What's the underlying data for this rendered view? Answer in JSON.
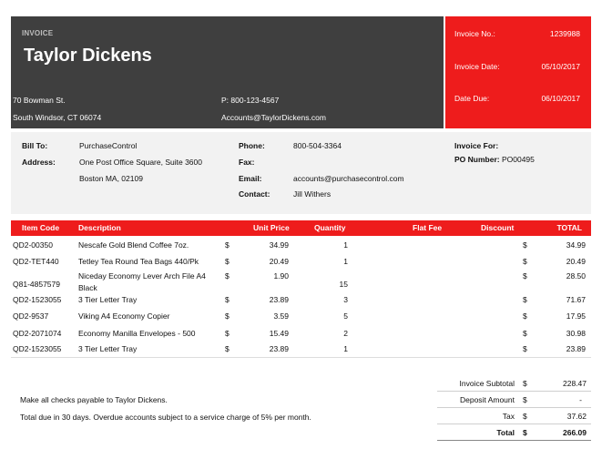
{
  "header": {
    "label": "INVOICE",
    "company": "Taylor Dickens",
    "address_line1": "70 Bowman St.",
    "address_line2": "South Windsor, CT 06074",
    "phone": "P: 800-123-4567",
    "email": "Accounts@TaylorDickens.com"
  },
  "invoice_meta": {
    "number_label": "Invoice No.:",
    "number": "1239988",
    "date_label": "Invoice Date:",
    "date": "05/10/2017",
    "due_label": "Date Due:",
    "due": "06/10/2017"
  },
  "bill_to": {
    "bill_to_label": "Bill To:",
    "bill_to": "PurchaseControl",
    "address_label": "Address:",
    "address_line1": "One Post Office Square, Suite 3600",
    "address_line2": "Boston MA, 02109",
    "phone_label": "Phone:",
    "phone": "800-504-3364",
    "fax_label": "Fax:",
    "fax": "",
    "email_label": "Email:",
    "email": "accounts@purchasecontrol.com",
    "contact_label": "Contact:",
    "contact": "Jill Withers",
    "invoice_for_label": "Invoice For:",
    "po_label": "PO Number:",
    "po": "PO00495"
  },
  "table": {
    "headers": [
      "Item Code",
      "Description",
      "Unit Price",
      "Quantity",
      "Flat Fee",
      "Discount",
      "TOTAL"
    ],
    "currency": "$",
    "rows": [
      {
        "code": "QD2-00350",
        "desc1": "Nescafe Gold Blend Coffee 7oz.",
        "desc2": "",
        "price": "34.99",
        "qty": "1",
        "total": "34.99"
      },
      {
        "code": "QD2-TET440",
        "desc1": "Tetley Tea Round Tea Bags 440/Pk",
        "desc2": "",
        "price": "20.49",
        "qty": "1",
        "total": "20.49"
      },
      {
        "code": "Q81-4857579",
        "desc1": "Niceday Economy Lever Arch File A4",
        "desc2": "Black",
        "price": "1.90",
        "qty": "15",
        "total": "28.50"
      },
      {
        "code": "QD2-1523055",
        "desc1": "3 Tier Letter Tray",
        "desc2": "",
        "price": "23.89",
        "qty": "3",
        "total": "71.67"
      },
      {
        "code": "QD2-9537",
        "desc1": "Viking A4 Economy Copier",
        "desc2": "",
        "price": "3.59",
        "qty": "5",
        "total": "17.95"
      },
      {
        "code": "QD2-2071074",
        "desc1": "Economy Manilla Envelopes - 500",
        "desc2": "",
        "price": "15.49",
        "qty": "2",
        "total": "30.98"
      },
      {
        "code": "QD2-1523055",
        "desc1": "3 Tier Letter Tray",
        "desc2": "",
        "price": "23.89",
        "qty": "1",
        "total": "23.89"
      }
    ]
  },
  "footer": {
    "note1": "Make all checks payable to Taylor Dickens.",
    "note2": "Total due in 30 days. Overdue accounts subject to a service charge of 5% per month.",
    "subtotal_label": "Invoice Subtotal",
    "subtotal": "228.47",
    "deposit_label": "Deposit Amount",
    "deposit": "-",
    "tax_label": "Tax",
    "tax": "37.62",
    "total_label": "Total",
    "total": "266.09"
  }
}
